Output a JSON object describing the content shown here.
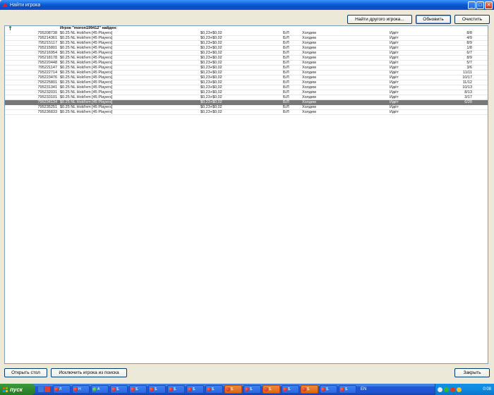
{
  "window": {
    "title": "Найти игрока",
    "buttons": {
      "minimize": "_",
      "maximize": "□",
      "close": "✕"
    }
  },
  "toolbar": {
    "find_other_label": "Найти другого игрока...",
    "refresh_label": "Обновить",
    "clear_label": "Очистить"
  },
  "results": {
    "found_message": "Игрок \"moron199412\" найден:",
    "rows": [
      {
        "id": "795208738",
        "game": "$0.25 NL Hold'em [45 Players]",
        "stakes": "$0,23+$0,02",
        "limit": "Б/Л",
        "type": "Холдем",
        "status": "Идёт",
        "seats": "8/8"
      },
      {
        "id": "795214361",
        "game": "$0.25 NL Hold'em [45 Players]",
        "stakes": "$0,23+$0,02",
        "limit": "Б/Л",
        "type": "Холдем",
        "status": "Идёт",
        "seats": "4/9"
      },
      {
        "id": "795215117",
        "game": "$0.25 NL Hold'em [45 Players]",
        "stakes": "$0,23+$0,02",
        "limit": "Б/Л",
        "type": "Холдем",
        "status": "Идёт",
        "seats": "8/9"
      },
      {
        "id": "795215801",
        "game": "$0.25 NL Hold'em [45 Players]",
        "stakes": "$0,23+$0,02",
        "limit": "Б/Л",
        "type": "Холдем",
        "status": "Идёт",
        "seats": "1/8"
      },
      {
        "id": "795216954",
        "game": "$0.25 NL Hold'em [45 Players]",
        "stakes": "$0,23+$0,02",
        "limit": "Б/Л",
        "type": "Холдем",
        "status": "Идёт",
        "seats": "6/7"
      },
      {
        "id": "795218178",
        "game": "$0.25 NL Hold'em [45 Players]",
        "stakes": "$0,23+$0,02",
        "limit": "Б/Л",
        "type": "Холдем",
        "status": "Идёт",
        "seats": "8/9"
      },
      {
        "id": "795220448",
        "game": "$0.25 NL Hold'em [45 Players]",
        "stakes": "$0,23+$0,02",
        "limit": "Б/Л",
        "type": "Холдем",
        "status": "Идёт",
        "seats": "5/7"
      },
      {
        "id": "795221147",
        "game": "$0.25 NL Hold'em [45 Players]",
        "stakes": "$0,23+$0,02",
        "limit": "Б/Л",
        "type": "Холдем",
        "status": "Идёт",
        "seats": "3/6"
      },
      {
        "id": "795222714",
        "game": "$0.25 NL Hold'em [45 Players]",
        "stakes": "$0,23+$0,02",
        "limit": "Б/Л",
        "type": "Холдем",
        "status": "Идёт",
        "seats": "11/11"
      },
      {
        "id": "795223476",
        "game": "$0.25 NL Hold'em [45 Players]",
        "stakes": "$0,23+$0,02",
        "limit": "Б/Л",
        "type": "Холдем",
        "status": "Идёт",
        "seats": "10/17"
      },
      {
        "id": "795225801",
        "game": "$0.25 NL Hold'em [45 Players]",
        "stakes": "$0,23+$0,02",
        "limit": "Б/Л",
        "type": "Холдем",
        "status": "Идёт",
        "seats": "11/12"
      },
      {
        "id": "795231341",
        "game": "$0.25 NL Hold'em [45 Players]",
        "stakes": "$0,23+$0,02",
        "limit": "Б/Л",
        "type": "Холдем",
        "status": "Идёт",
        "seats": "10/13"
      },
      {
        "id": "795232031",
        "game": "$0.25 NL Hold'em [45 Players]",
        "stakes": "$0,23+$0,02",
        "limit": "Б/Л",
        "type": "Холдем",
        "status": "Идёт",
        "seats": "8/13"
      },
      {
        "id": "795233101",
        "game": "$0.25 NL Hold'em [45 Players]",
        "stakes": "$0,23+$0,02",
        "limit": "Б/Л",
        "type": "Холдем",
        "status": "Идёт",
        "seats": "3/17"
      },
      {
        "id": "795234134",
        "game": "$0.25 NL Hold'em [45 Players]",
        "stakes": "$0,23+$0,02",
        "limit": "Б/Л",
        "type": "Холдем",
        "status": "Идёт",
        "seats": "6/20",
        "selected": true
      },
      {
        "id": "795235251",
        "game": "$0.25 NL Hold'em [45 Players]",
        "stakes": "$0,23+$0,02",
        "limit": "Б/Л",
        "type": "Холдем",
        "status": "Идёт",
        "seats": ""
      },
      {
        "id": "795236833",
        "game": "$0.25 NL Hold'em [45 Players]",
        "stakes": "$0,23+$0,02",
        "limit": "Б/Л",
        "type": "Холдем",
        "status": "Идёт",
        "seats": ""
      }
    ]
  },
  "footer": {
    "open_table_label": "Открыть стол",
    "exclude_player_label": "Исключить игрока из поиска",
    "close_label": "Закрыть"
  },
  "taskbar": {
    "start_label": "пуск",
    "tasks": [
      {
        "label": "Л",
        "icon": "red-circle",
        "active": false
      },
      {
        "label": "Н",
        "icon": "red-circle",
        "active": false
      },
      {
        "label": "А",
        "icon": "green-circle",
        "active": false
      },
      {
        "label": "$.",
        "icon": "red-circle",
        "active": false
      },
      {
        "label": "$.",
        "icon": "red-circle",
        "active": false
      },
      {
        "label": "$.",
        "icon": "red-circle",
        "active": false
      },
      {
        "label": "$.",
        "icon": "red-circle",
        "active": false
      },
      {
        "label": "$.",
        "icon": "red-circle",
        "active": false
      },
      {
        "label": "$.",
        "icon": "red-circle",
        "active": false
      },
      {
        "label": "$.",
        "icon": "red-circle",
        "active": true
      },
      {
        "label": "$.",
        "icon": "red-circle",
        "active": false
      },
      {
        "label": "$.",
        "icon": "red-circle",
        "active": true
      },
      {
        "label": "$.",
        "icon": "red-circle",
        "active": false
      },
      {
        "label": "$.",
        "icon": "red-circle",
        "active": true
      },
      {
        "label": "$.",
        "icon": "red-circle",
        "active": false
      },
      {
        "label": "$.",
        "icon": "red-circle",
        "active": false
      }
    ],
    "language": "EN",
    "clock": "0:08"
  },
  "colors": {
    "titlebar": "#0a5fd6",
    "selected_row": "#777777",
    "taskbar": "#2157d7",
    "start_button": "#2f8a2f",
    "active_task": "#e06510"
  }
}
